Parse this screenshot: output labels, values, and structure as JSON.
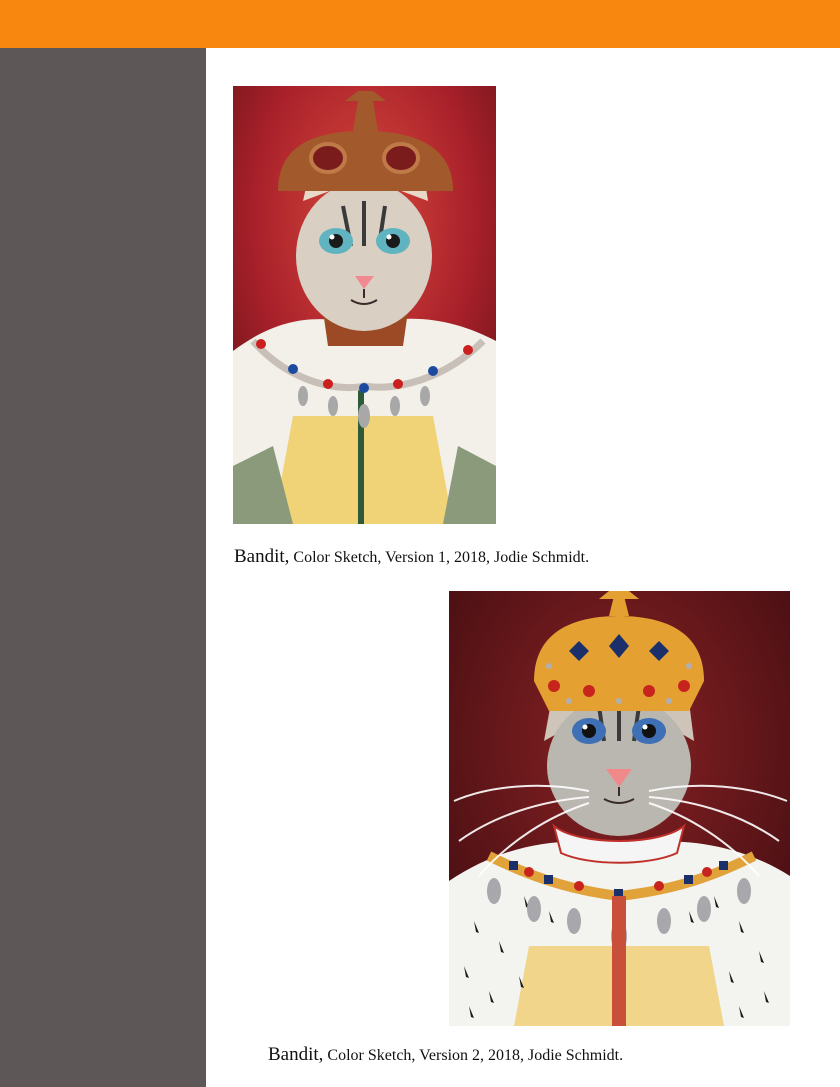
{
  "colors": {
    "accent_bar": "#f7870f",
    "sidebar": "#5e5758",
    "page": "#ffffff"
  },
  "figures": [
    {
      "image_label": "Bandit cat king painting, version 1",
      "caption_title": "Bandit,",
      "caption_details": "Color Sketch, Version 1, 2018, Jodie Schmidt."
    },
    {
      "image_label": "Bandit cat king painting, version 2",
      "caption_title": "Bandit,",
      "caption_details": "Color Sketch, Version 2, 2018, Jodie Schmidt."
    }
  ]
}
